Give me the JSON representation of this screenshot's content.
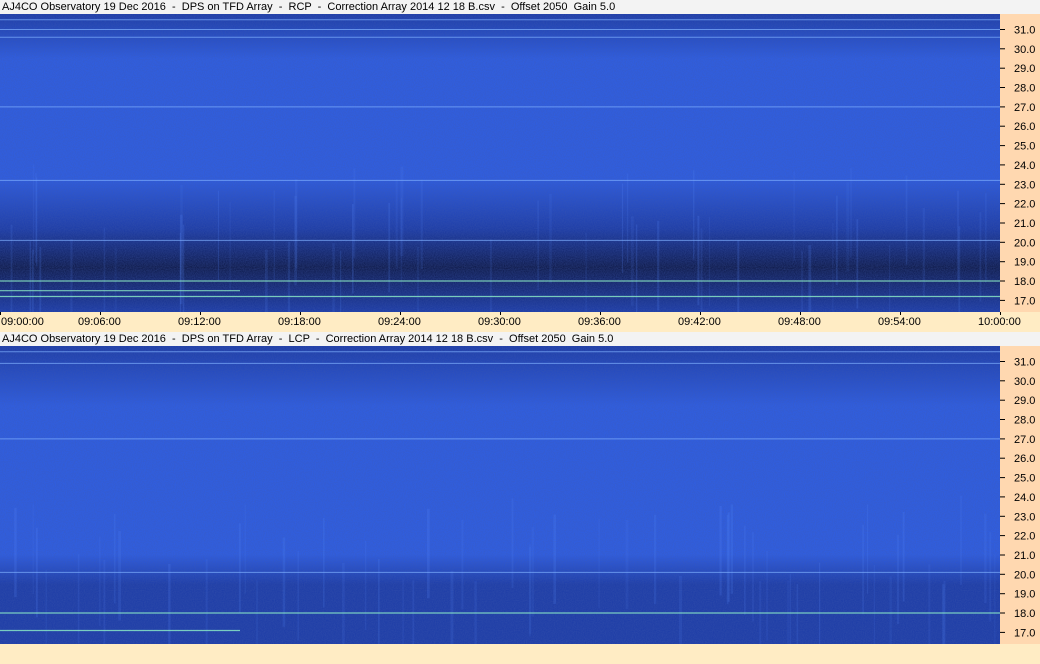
{
  "panels": [
    {
      "title": "AJ4CO Observatory 19 Dec 2016  -  DPS on TFD Array  -  RCP  -  Correction Array 2014 12 18 B.csv  -  Offset 2050  Gain 5.0"
    },
    {
      "title": "AJ4CO Observatory 19 Dec 2016  -  DPS on TFD Array  -  LCP  -  Correction Array 2014 12 18 B.csv  -  Offset 2050  Gain 5.0"
    }
  ],
  "chart_data": [
    {
      "type": "heatmap",
      "title": "AJ4CO Observatory 19 Dec 2016  -  DPS on TFD Array  -  RCP  -  Correction Array 2014 12 18 B.csv  -  Offset 2050  Gain 5.0",
      "x_ticks": [
        "09:00:00",
        "09:06:00",
        "09:12:00",
        "09:18:00",
        "09:24:00",
        "09:30:00",
        "09:36:00",
        "09:42:00",
        "09:48:00",
        "09:54:00",
        "10:00:00"
      ],
      "y_ticks": [
        "31.0",
        "30.0",
        "29.0",
        "28.0",
        "27.0",
        "26.0",
        "25.0",
        "24.0",
        "23.0",
        "22.0",
        "21.0",
        "20.0",
        "19.0",
        "18.0",
        "17.0"
      ],
      "xlim": [
        "09:00:00",
        "10:00:00"
      ],
      "ylim": [
        16.4,
        31.8
      ],
      "colormap": [
        "#0a1440",
        "#1a3aa8",
        "#2d5ee8",
        "#4a86ff"
      ],
      "rfi_lines_mhz": [
        31.5,
        31.0,
        30.6,
        27.0,
        23.2,
        20.1,
        18.0,
        17.5,
        17.2
      ],
      "hot_line_color": "#8ef0c8"
    },
    {
      "type": "heatmap",
      "title": "AJ4CO Observatory 19 Dec 2016  -  DPS on TFD Array  -  LCP  -  Correction Array 2014 12 18 B.csv  -  Offset 2050  Gain 5.0",
      "x_ticks": [],
      "y_ticks": [
        "31.0",
        "30.0",
        "29.0",
        "28.0",
        "27.0",
        "26.0",
        "25.0",
        "24.0",
        "23.0",
        "22.0",
        "21.0",
        "20.0",
        "19.0",
        "18.0",
        "17.0"
      ],
      "xlim": [
        "09:00:00",
        "10:00:00"
      ],
      "ylim": [
        16.4,
        31.8
      ],
      "colormap": [
        "#0a1440",
        "#1a3aa8",
        "#2d5ee8",
        "#4a86ff"
      ],
      "rfi_lines_mhz": [
        31.5,
        30.9,
        27.0,
        20.1,
        18.0,
        17.1
      ],
      "hot_line_color": "#8ef0c8"
    }
  ]
}
